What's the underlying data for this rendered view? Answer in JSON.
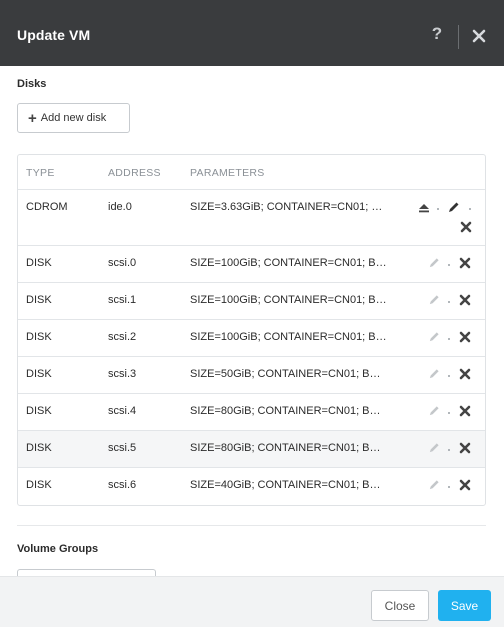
{
  "dialog": {
    "title": "Update VM",
    "help_icon": "?"
  },
  "disks_section": {
    "title": "Disks",
    "add_button_icon": "+",
    "add_button_label": "Add new disk"
  },
  "table": {
    "headers": [
      "TYPE",
      "ADDRESS",
      "PARAMETERS"
    ],
    "rows": [
      {
        "type": "CDROM",
        "address": "ide.0",
        "parameters": "SIZE=3.63GiB; CONTAINER=CN01; …"
      },
      {
        "type": "DISK",
        "address": "scsi.0",
        "parameters": "SIZE=100GiB; CONTAINER=CN01; B…"
      },
      {
        "type": "DISK",
        "address": "scsi.1",
        "parameters": "SIZE=100GiB; CONTAINER=CN01; B…"
      },
      {
        "type": "DISK",
        "address": "scsi.2",
        "parameters": "SIZE=100GiB; CONTAINER=CN01; B…"
      },
      {
        "type": "DISK",
        "address": "scsi.3",
        "parameters": "SIZE=50GiB; CONTAINER=CN01; B…"
      },
      {
        "type": "DISK",
        "address": "scsi.4",
        "parameters": "SIZE=80GiB; CONTAINER=CN01; B…"
      },
      {
        "type": "DISK",
        "address": "scsi.5",
        "parameters": "SIZE=80GiB; CONTAINER=CN01; B…"
      },
      {
        "type": "DISK",
        "address": "scsi.6",
        "parameters": "SIZE=40GiB; CONTAINER=CN01; B…"
      }
    ]
  },
  "volume_groups_section": {
    "title": "Volume Groups"
  },
  "footer": {
    "close_label": "Close",
    "save_label": "Save"
  },
  "colors": {
    "header_bg": "#3a3c3e",
    "primary": "#20b1ef",
    "highlight_row": "#f5f6f7"
  },
  "icons": {
    "header": [
      "help-icon",
      "close-icon"
    ],
    "cdrom_row": [
      "eject-icon",
      "edit-icon",
      "delete-icon"
    ],
    "disk_row": [
      "edit-icon",
      "delete-icon"
    ]
  }
}
